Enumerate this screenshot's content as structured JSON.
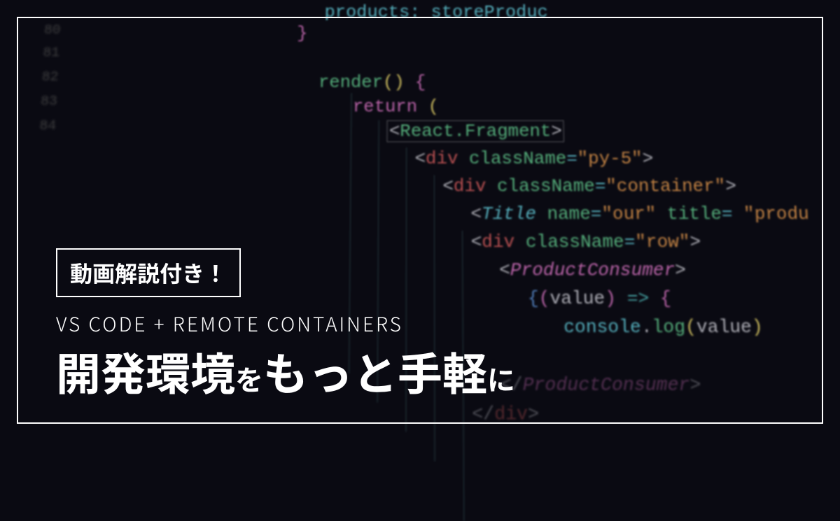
{
  "overlay": {
    "badge": "動画解説付き！",
    "subtitle": "VS CODE + REMOTE CONTAINERS",
    "headline_part1": "開発環境",
    "headline_particle1": "を",
    "headline_part2": "もっと手軽",
    "headline_particle2": "に"
  },
  "code": {
    "line_top": "products: storeProduc",
    "line0": "}",
    "line1_kw": "render",
    "line1_paren": "()",
    "line1_brace": " {",
    "line2_kw": "return",
    "line2_paren": " (",
    "line3_open": "<",
    "line3_tag": "React.Fragment",
    "line3_close": ">",
    "line4": "<div className=\"py-5\">",
    "line5": "<div className=\"container\">",
    "line6": "<Title name=\"our\" title= \"produ",
    "line7": "<div className=\"row\">",
    "line8": "<ProductConsumer>",
    "line9": "{(value) => {",
    "line10": "console.log(value)",
    "line11_close": "</ProductConsumer>",
    "line12_close": "</div>"
  }
}
